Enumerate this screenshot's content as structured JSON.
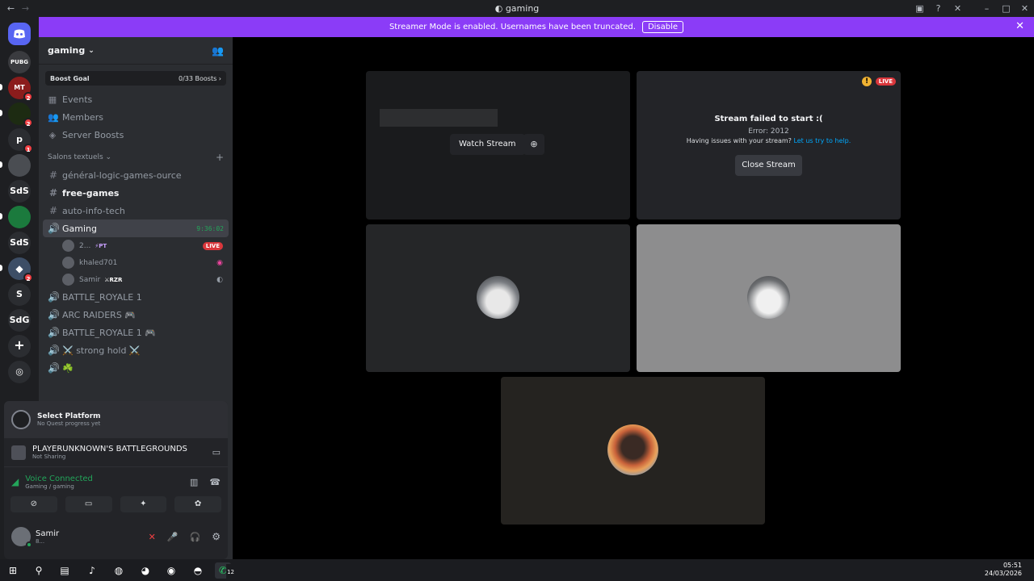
{
  "window": {
    "title": "gaming"
  },
  "banner": {
    "text": "Streamer Mode is enabled. Usernames have been truncated.",
    "button": "Disable"
  },
  "rail": {
    "servers": [
      {
        "label": "PUBG",
        "badge": ""
      },
      {
        "label": "MT",
        "badge": "2"
      },
      {
        "label": "",
        "badge": "2"
      },
      {
        "label": "p",
        "badge": "1"
      },
      {
        "label": "",
        "badge": ""
      },
      {
        "label": "SdS",
        "badge": ""
      },
      {
        "label": "",
        "badge": ""
      },
      {
        "label": "SdS",
        "badge": ""
      },
      {
        "label": "",
        "badge": "2"
      },
      {
        "label": "S",
        "badge": ""
      },
      {
        "label": "SdG",
        "badge": ""
      }
    ]
  },
  "sidebar": {
    "guild_name": "gaming",
    "boost": {
      "label": "Boost Goal",
      "count": "0/33 Boosts"
    },
    "nav": [
      "Events",
      "Members",
      "Server Boosts"
    ],
    "category": "Salons textuels",
    "text_channels": [
      "général-logic-games-ource",
      "free-games",
      "auto-info-tech"
    ],
    "voice_active": {
      "name": "Gaming",
      "timer": "9:36:02"
    },
    "voice_users": [
      {
        "name": "2...",
        "tag": "PT",
        "live": "LIVE"
      },
      {
        "name": "khaled701",
        "tag": "",
        "live": ""
      },
      {
        "name": "Samir",
        "tag": "RZR",
        "live": ""
      }
    ],
    "voice_channels": [
      "BATTLE_ROYALE 1",
      "ARC RAIDERS 🎮",
      "BATTLE_ROYALE 1 🎮",
      "⚔️ strong hold ⚔️",
      "☘️"
    ]
  },
  "panel": {
    "quest_title": "Select Platform",
    "quest_sub": "No Quest progress yet",
    "game_title": "PLAYERUNKNOWN'S BATTLEGROUNDS",
    "game_sub": "Not Sharing",
    "voice_title": "Voice Connected",
    "voice_sub": "Gaming / gaming",
    "user_name": "Samir",
    "user_status": "8..."
  },
  "stage": {
    "watch_label": "Watch Stream",
    "error_title": "Stream failed to start :(",
    "error_code": "Error: 2012",
    "error_help": "Having issues with your stream?",
    "error_link": "Let us try to help.",
    "close_label": "Close Stream",
    "live": "LIVE"
  },
  "taskbar": {
    "time": "05:51",
    "date": "24/03/2026",
    "whatsapp_badge": "12"
  },
  "colors": {
    "blurple": "#5865f2",
    "streamer": "#8b3cf7",
    "live": "#da373c",
    "voice_green": "#23a55a",
    "link": "#00a8fc"
  }
}
